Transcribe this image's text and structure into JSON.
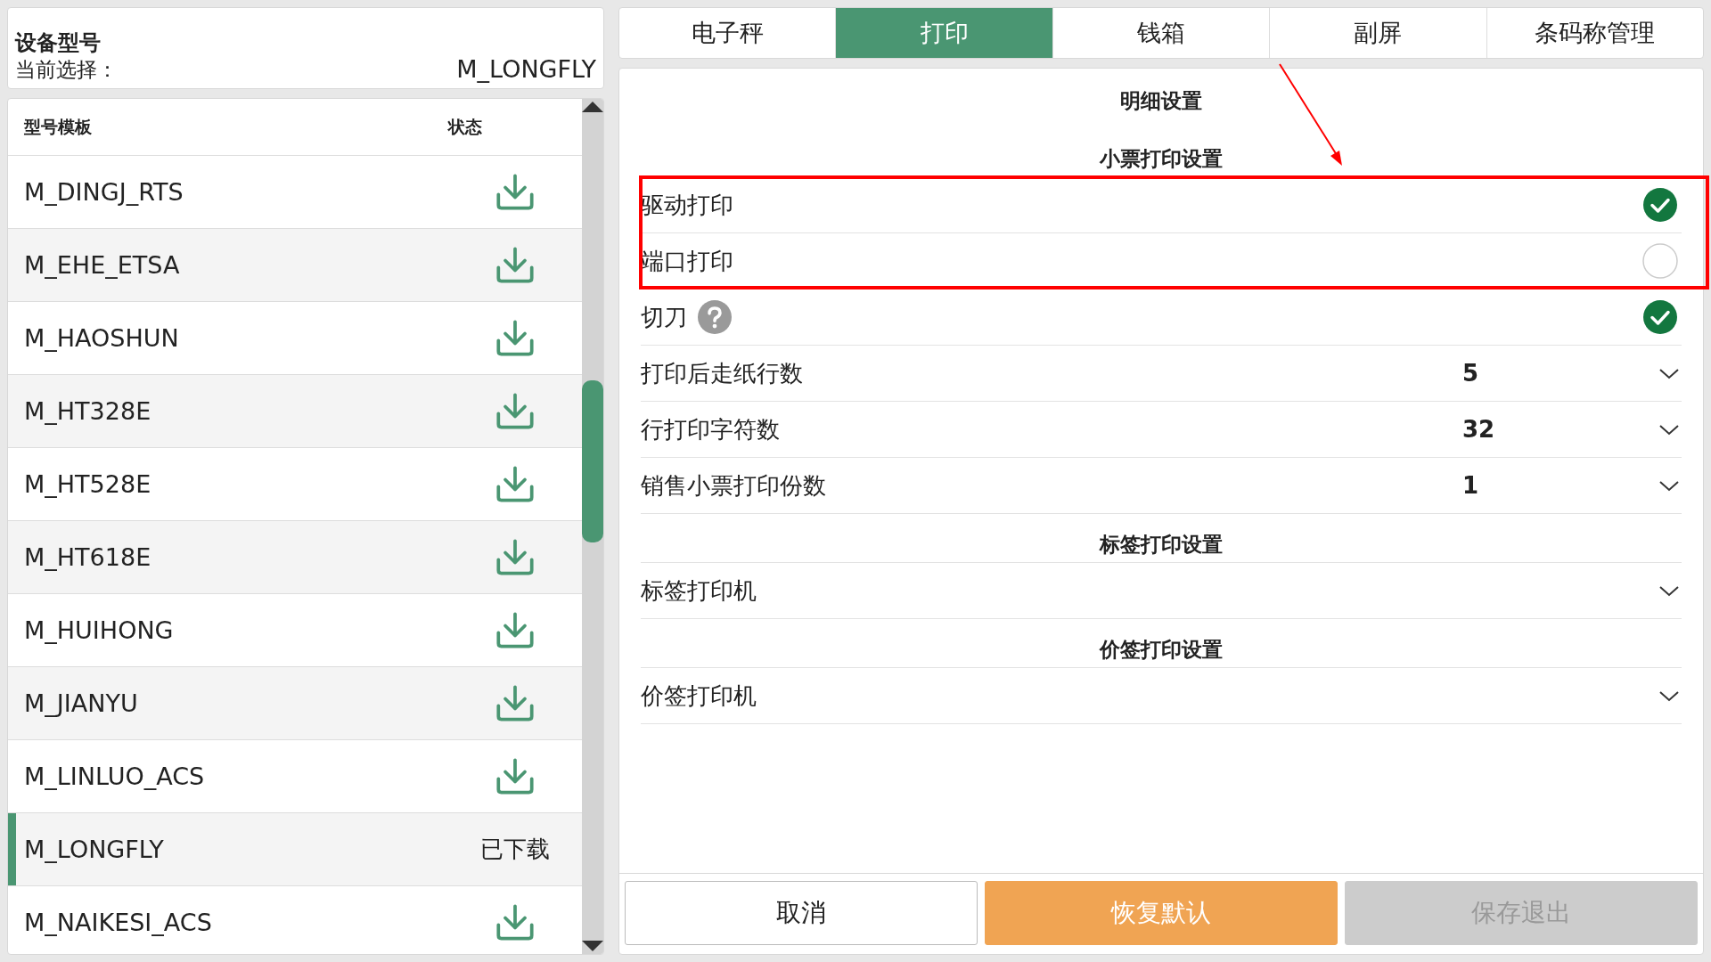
{
  "device": {
    "title": "设备型号",
    "current_label": "当前选择：",
    "current_value": "M_LONGFLY"
  },
  "models": {
    "columns": [
      "型号模板",
      "状态"
    ],
    "rows": [
      {
        "name": "M_DINGJ_RTS",
        "downloaded": false,
        "selected": false
      },
      {
        "name": "M_EHE_ETSA",
        "downloaded": false,
        "selected": false
      },
      {
        "name": "M_HAOSHUN",
        "downloaded": false,
        "selected": false
      },
      {
        "name": "M_HT328E",
        "downloaded": false,
        "selected": false
      },
      {
        "name": "M_HT528E",
        "downloaded": false,
        "selected": false
      },
      {
        "name": "M_HT618E",
        "downloaded": false,
        "selected": false
      },
      {
        "name": "M_HUIHONG",
        "downloaded": false,
        "selected": false
      },
      {
        "name": "M_JIANYU",
        "downloaded": false,
        "selected": false
      },
      {
        "name": "M_LINLUO_ACS",
        "downloaded": false,
        "selected": false
      },
      {
        "name": "M_LONGFLY",
        "downloaded": true,
        "status": "已下载",
        "selected": true
      },
      {
        "name": "M_NAIKESI_ACS",
        "downloaded": false,
        "selected": false
      }
    ]
  },
  "tabs": [
    {
      "label": "电子秤",
      "selected": false
    },
    {
      "label": "打印",
      "selected": true
    },
    {
      "label": "钱箱",
      "selected": false
    },
    {
      "label": "副屏",
      "selected": false
    },
    {
      "label": "条码称管理",
      "selected": false
    }
  ],
  "settings": {
    "title": "明细设置",
    "sections": [
      {
        "title": "小票打印设置",
        "rows": [
          {
            "kind": "check",
            "label": "驱动打印",
            "checked": true,
            "highlighted": true
          },
          {
            "kind": "check",
            "label": "端口打印",
            "checked": false,
            "highlighted": true
          },
          {
            "kind": "check",
            "label": "切刀",
            "checked": true,
            "help": true
          },
          {
            "kind": "select",
            "label": "打印后走纸行数",
            "value": "5"
          },
          {
            "kind": "select",
            "label": "行打印字符数",
            "value": "32"
          },
          {
            "kind": "select",
            "label": "销售小票打印份数",
            "value": "1"
          }
        ]
      },
      {
        "title": "标签打印设置",
        "rows": [
          {
            "kind": "select",
            "label": "标签打印机"
          }
        ]
      },
      {
        "title": "价签打印设置",
        "rows": [
          {
            "kind": "select",
            "label": "价签打印机"
          }
        ]
      }
    ]
  },
  "buttons": [
    {
      "label": "取消",
      "kind": "default",
      "disabled": false
    },
    {
      "label": "恢复默认",
      "kind": "primary",
      "disabled": false
    },
    {
      "label": "保存退出",
      "kind": "default",
      "disabled": true
    }
  ]
}
